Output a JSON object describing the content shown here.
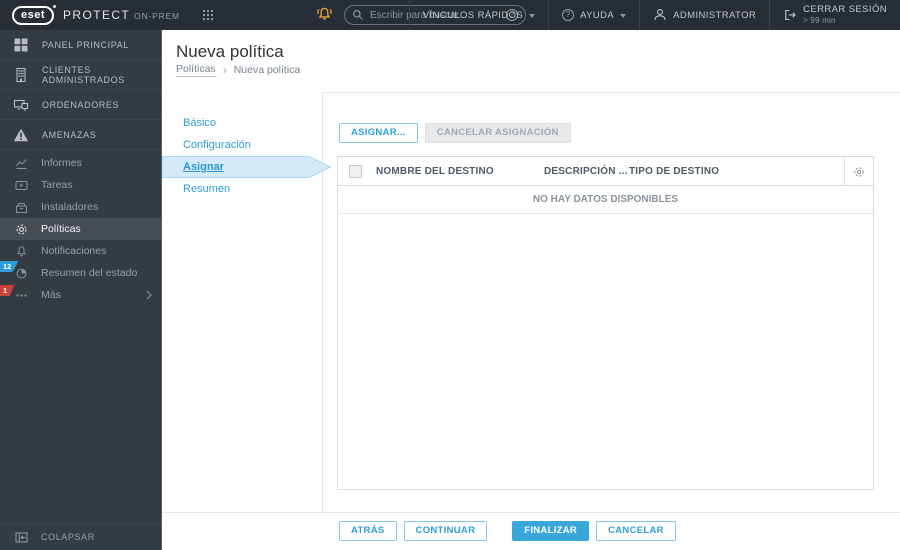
{
  "topbar": {
    "logo": "eset",
    "product": "PROTECT",
    "product_suffix": "ON-PREM",
    "search_placeholder": "Escribir para buscar...",
    "quick_links": "VÍNCULOS RÁPIDOS",
    "help": "AYUDA",
    "user": "ADMINISTRATOR",
    "logout": "CERRAR SESIÓN",
    "logout_sub": "> 99 min"
  },
  "sidebar": {
    "primary": [
      {
        "label": "PANEL PRINCIPAL",
        "icon": "dashboard-icon"
      },
      {
        "label": "CLIENTES ADMINISTRADOS",
        "icon": "managed-clients-icon"
      },
      {
        "label": "ORDENADORES",
        "icon": "computers-icon"
      },
      {
        "label": "AMENAZAS",
        "icon": "threats-icon"
      }
    ],
    "secondary": [
      {
        "label": "Informes",
        "icon": "reports-icon"
      },
      {
        "label": "Tareas",
        "icon": "tasks-icon"
      },
      {
        "label": "Instaladores",
        "icon": "installers-icon"
      },
      {
        "label": "Políticas",
        "icon": "policies-icon",
        "selected": true
      },
      {
        "label": "Notificaciones",
        "icon": "notifications-icon"
      },
      {
        "label": "Resumen del estado",
        "icon": "status-overview-icon",
        "badge": "12"
      },
      {
        "label": "Más",
        "icon": "more-icon",
        "badge": "1"
      }
    ],
    "collapse": "COLAPSAR"
  },
  "page": {
    "title": "Nueva política",
    "breadcrumb_parent": "Políticas",
    "breadcrumb_current": "Nueva política"
  },
  "wizard": {
    "steps": [
      "Básico",
      "Configuración",
      "Asignar",
      "Resumen"
    ],
    "active_step": "Asignar"
  },
  "toolbar": {
    "assign_label": "ASIGNAR...",
    "cancel_assignment_label": "CANCELAR ASIGNACIÓN"
  },
  "table": {
    "columns": [
      "NOMBRE DEL DESTINO",
      "DESCRIPCIÓN ...",
      "TIPO DE DESTINO"
    ],
    "empty_text": "NO HAY DATOS DISPONIBLES"
  },
  "footer": {
    "back_label": "ATRÁS",
    "continue_label": "CONTINUAR",
    "finish_label": "FINALIZAR",
    "cancel_label": "CANCELAR"
  },
  "colors": {
    "accent": "#2f9ed6",
    "accent_solid": "#3aa7db",
    "topbar_bg": "#262d34",
    "sidebar_bg": "#343b43",
    "bell": "#e9a63c",
    "badge_blue": "#2f9ed6",
    "badge_red": "#c9413d"
  }
}
